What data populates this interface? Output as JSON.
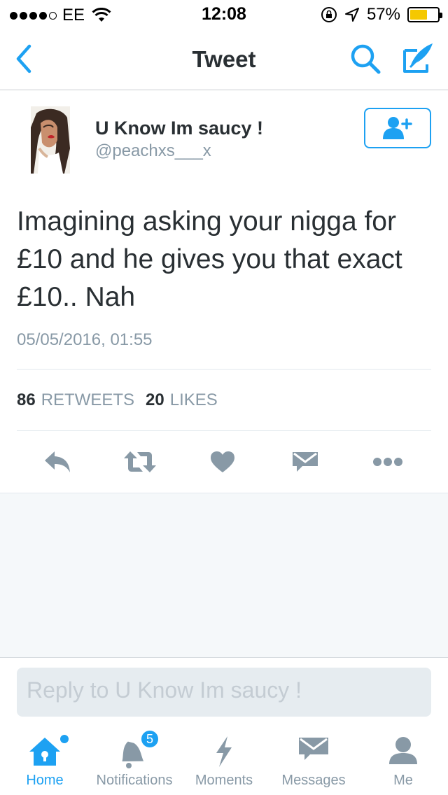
{
  "status_bar": {
    "carrier": "EE",
    "time": "12:08",
    "battery": "57%"
  },
  "nav": {
    "title": "Tweet"
  },
  "tweet": {
    "user_name": "U Know Im saucy !",
    "handle": "@peachxs___x",
    "text": "Imagining asking your nigga for £10 and he gives you that exact £10.. Nah",
    "timestamp": "05/05/2016, 01:55",
    "retweets_count": "86",
    "retweets_label": "RETWEETS",
    "likes_count": "20",
    "likes_label": "LIKES"
  },
  "reply": {
    "placeholder": "Reply to U Know Im saucy !"
  },
  "tabs": [
    {
      "label": "Home",
      "icon": "home-icon"
    },
    {
      "label": "Notifications",
      "icon": "bell-icon",
      "badge": "5"
    },
    {
      "label": "Moments",
      "icon": "lightning-icon"
    },
    {
      "label": "Messages",
      "icon": "envelope-icon"
    },
    {
      "label": "Me",
      "icon": "person-icon"
    }
  ],
  "colors": {
    "accent": "#1da1f2",
    "icon_gray": "#8899a6",
    "text": "#292f33"
  }
}
